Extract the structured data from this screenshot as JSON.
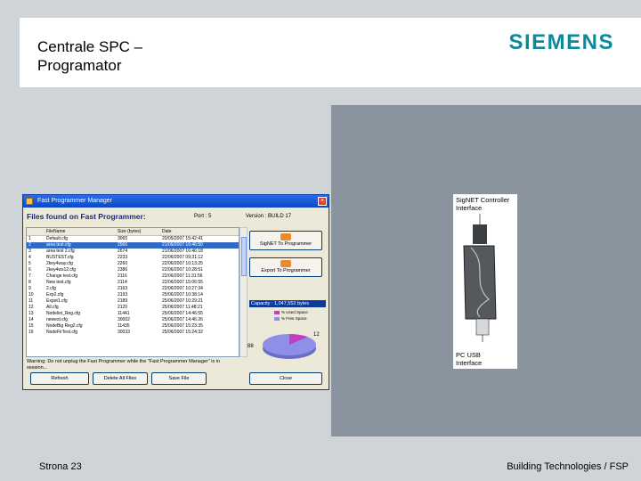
{
  "slide": {
    "title_line1": "Centrale SPC –",
    "title_line2": "Programator",
    "logo": "SIEMENS",
    "footer_left": "Strona 23",
    "footer_right": "Building Technologies / FSP",
    "colors": {
      "logo": "#0a8a9a",
      "right_panel": "#8a949e",
      "background": "#cfd4d9"
    }
  },
  "device": {
    "top_label_line1": "SigNET Controller",
    "top_label_line2": "Interface",
    "bottom_label_line1": "PC USB",
    "bottom_label_line2": "Interface"
  },
  "window": {
    "title": "Fast Programmer Manager",
    "files_header": "Files found on Fast Programmer:",
    "port": "Port : 5",
    "version": "Version : BUILD 17",
    "columns": [
      "",
      "FileName",
      "Size (bytes)",
      "Date"
    ],
    "rows": [
      [
        "1",
        "Default.cfg",
        "3065",
        "20/05/2007 15:42:41"
      ],
      [
        "2",
        "area test.cfg",
        "2566",
        "21/06/2007 16:46:50"
      ],
      [
        "3",
        "area test 2.cfg",
        "2674",
        "21/06/2007 16:46:18"
      ],
      [
        "4",
        "BUSTEST.cfg",
        "2233",
        "22/06/2007 09:31:12"
      ],
      [
        "5",
        "2key4way.cfg",
        "2260",
        "22/06/2007 10:13:25"
      ],
      [
        "6",
        "2key4ws12.cfg",
        "2386",
        "22/06/2007 10:28:51"
      ],
      [
        "7",
        "Change test.cfg",
        "2116",
        "22/06/2007 11:31:56"
      ],
      [
        "8",
        "New test.cfg",
        "2114",
        "22/06/2007 15:06:55"
      ],
      [
        "9",
        "2.cfg",
        "2163",
        "22/06/2007 10:27:34"
      ],
      [
        "10",
        "Exp2.cfg",
        "2193",
        "25/06/2007 10:38:14"
      ],
      [
        "11",
        "Expot1.cfg",
        "2189",
        "25/06/2007 10:29:21"
      ],
      [
        "12",
        "All.cfg",
        "2120",
        "25/06/2007 11:48:21"
      ],
      [
        "13",
        "Nodelist_Reg.cfg",
        "11441",
        "25/06/2007 14:46:55"
      ],
      [
        "14",
        "newest.cfg",
        "30002",
        "25/06/2007 14:46:26"
      ],
      [
        "15",
        "NodeBig Reg2.cfg",
        "11435",
        "25/06/2007 15:23:35"
      ],
      [
        "16",
        "NodeFirTest.cfg",
        "30033",
        "25/06/2007 15:24:32"
      ]
    ],
    "warning": "Warning: Do not unplug the Fast Programmer while the \"Fast Programmer Manager\" is in session...",
    "buttons": {
      "signet": "SigNET To Programmer",
      "export": "Export To Programmer",
      "refresh": "Refresh",
      "delete_all": "Delete All Files",
      "save": "Save File",
      "close": "Close"
    },
    "capacity_label": "Capacity : 1,047,552 bytes",
    "legend": [
      {
        "label": "% Used Space",
        "color": "#c13ec1"
      },
      {
        "label": "% Free Space",
        "color": "#8e90e8"
      }
    ],
    "pie": {
      "used_percent": 12,
      "free_percent": 88
    }
  }
}
